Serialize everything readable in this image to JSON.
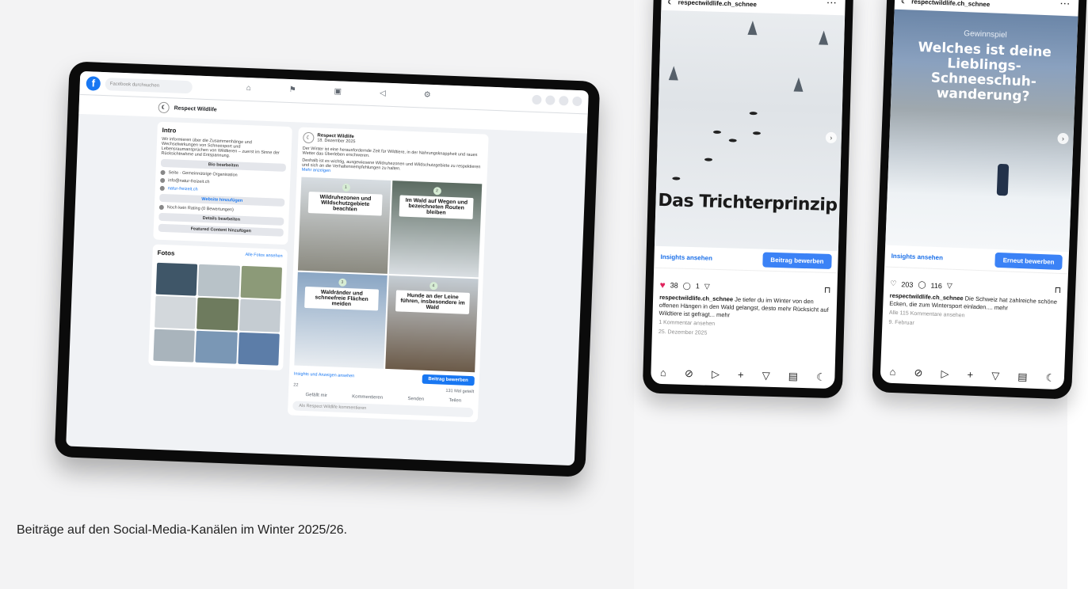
{
  "caption": "Beiträge auf den Social-Media-Kanälen im Winter 2025/26.",
  "facebook": {
    "search_placeholder": "Facebook durchsuchen",
    "page_name": "Respect Wildlife",
    "intro_title": "Intro",
    "intro_text": "Wir informieren über die Zusammenhänge und Wechselwirkungen von Schneesport und Lebensraumansprüchen von Wildtieren – zuerst im Sinne der Rücksichtnahme und Entspannung.",
    "edit_bio": "Bio bearbeiten",
    "category": "Seite · Gemeinnützige Organisation",
    "email": "info@natur-freizeit.ch",
    "website": "natur-freizeit.ch",
    "website_btn": "Website hinzufügen",
    "rating": "Noch kein Rating (0 Bewertungen)",
    "details_btn": "Details bearbeiten",
    "featured_btn": "Featured Content hinzufügen",
    "photos_title": "Fotos",
    "photos_link": "Alle Fotos ansehen",
    "post_author": "Respect Wildlife",
    "post_date": "18. Dezember 2025",
    "post_text": "Der Winter ist eine herausfordernde Zeit für Wildtiere, in der Nahrungsknappheit und raues Wetter das Überleben erschweren.",
    "post_text2": "Deshalb ist es wichtig, ausgewiesene Wildruhezonen und Wildschutzgebiete zu respektieren und sich an die Verhaltensempfehlungen zu halten.",
    "post_more": "Mehr anzeigen",
    "tiles": [
      {
        "num": "1",
        "label": "Wildruhezonen und Wildschutzgebiete beachten"
      },
      {
        "num": "2",
        "label": "Im Wald auf Wegen und bezeichneten Routen bleiben"
      },
      {
        "num": "3",
        "label": "Waldränder und schneefreie Flächen meiden"
      },
      {
        "num": "4",
        "label": "Hunde an der Leine führen, insbesondere im Wald"
      }
    ],
    "insights_link": "Insights und Anzeigen ansehen",
    "boost_btn": "Beitrag bewerben",
    "reactions": "22",
    "views": "131 Mal geteilt",
    "like": "Gefällt mir",
    "comment": "Kommentieren",
    "share": "Senden",
    "teilen": "Teilen",
    "comment_placeholder": "Als Respect Wildlife kommentieren"
  },
  "instagram": [
    {
      "account": "respectwildlife.ch_schnee",
      "more": "···",
      "image_title": "Das Trichterprinzip",
      "insights": "Insights ansehen",
      "button": "Beitrag bewerben",
      "likes": "38",
      "comments": "1",
      "caption_user": "respectwildlife.ch_schnee",
      "caption_text": " Je tiefer du im Winter von den offenen Hängen in den Wald gelangst, desto mehr Rücksicht auf Wildtiere ist gefragt... mehr",
      "view_comments": "1 Kommentar ansehen",
      "date": "25. Dezember 2025"
    },
    {
      "account": "respectwildlife.ch_schnee",
      "more": "···",
      "image_sub": "Gewinnspiel",
      "image_title": "Welches ist deine Lieblings-Schneeschuh-wanderung?",
      "insights": "Insights ansehen",
      "button": "Erneut bewerben",
      "likes": "203",
      "comments": "116",
      "caption_user": "respectwildlife.ch_schnee",
      "caption_text": " Die Schweiz hat zahlreiche schöne Ecken, die zum Wintersport einladen.... mehr",
      "view_comments": "Alle 115 Kommentare ansehen",
      "date": "9. Februar"
    }
  ]
}
